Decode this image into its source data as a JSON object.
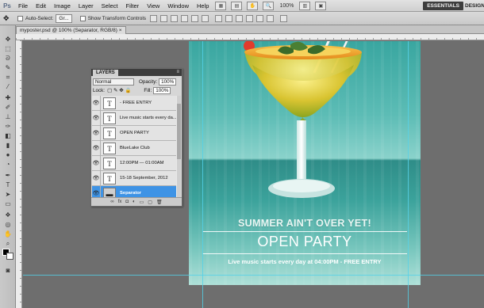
{
  "menubar": {
    "logo": "Ps",
    "items": [
      "File",
      "Edit",
      "Image",
      "Layer",
      "Select",
      "Filter",
      "View",
      "Window",
      "Help"
    ],
    "zoom": "100%",
    "workspaces": [
      "ESSENTIALS",
      "DESIGN"
    ]
  },
  "options": {
    "auto_select_label": "Auto-Select:",
    "auto_select_value": "Gr...",
    "show_transform_label": "Show Transform Controls"
  },
  "document": {
    "tab_label": "myposter.psd @ 100% (Separator, RGB/8) ×"
  },
  "poster": {
    "headline": "SUMMER AIN'T OVER YET!",
    "title": "OPEN PARTY",
    "subtitle": "Live music starts every day at 04:00PM  -  FREE ENTRY"
  },
  "layers_panel": {
    "tab": "LAYERS",
    "blend_mode": "Normal",
    "opacity_label": "Opacity:",
    "opacity": "100%",
    "lock_label": "Lock:",
    "fill_label": "Fill:",
    "fill": "100%",
    "layers": [
      {
        "name": "- FREE ENTRY",
        "type": "T",
        "selected": false
      },
      {
        "name": "Live music starts every da...",
        "type": "T",
        "selected": false
      },
      {
        "name": "OPEN PARTY",
        "type": "T",
        "selected": false
      },
      {
        "name": "BlueLake Club",
        "type": "T",
        "selected": false
      },
      {
        "name": "12:00PM — 01:00AM",
        "type": "T",
        "selected": false
      },
      {
        "name": "15-18 September, 2012",
        "type": "T",
        "selected": false
      },
      {
        "name": "Separator",
        "type": "img",
        "selected": true
      }
    ]
  },
  "colors": {
    "poster_teal": "#39a6a0",
    "layer_selected": "#3e93e5",
    "guide": "#52d1e8"
  }
}
